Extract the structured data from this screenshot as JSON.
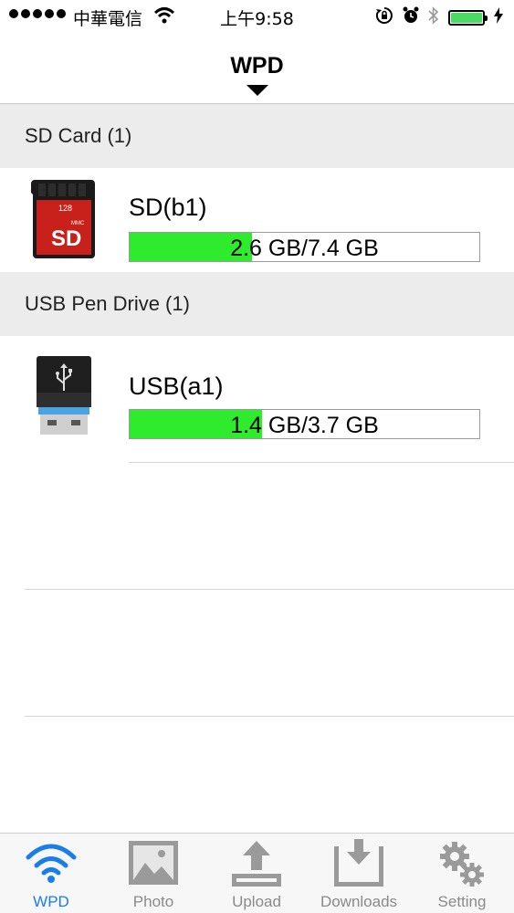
{
  "status_bar": {
    "carrier": "中華電信",
    "time": "上午9:58"
  },
  "nav": {
    "title": "WPD"
  },
  "sections": [
    {
      "header": "SD Card (1)",
      "device": {
        "name": "SD(b1)",
        "icon": "sd-card-icon",
        "icon_text_top": "128",
        "icon_text_brand": "MMC",
        "icon_text_main": "SD",
        "capacity_text": "2.6 GB/7.4 GB",
        "used_fraction": 0.351
      }
    },
    {
      "header": "USB Pen Drive (1)",
      "device": {
        "name": "USB(a1)",
        "icon": "usb-drive-icon",
        "capacity_text": "1.4 GB/3.7 GB",
        "used_fraction": 0.378
      }
    }
  ],
  "tabs": [
    {
      "label": "WPD",
      "icon": "wifi-icon",
      "active": true
    },
    {
      "label": "Photo",
      "icon": "photo-icon",
      "active": false
    },
    {
      "label": "Upload",
      "icon": "upload-icon",
      "active": false
    },
    {
      "label": "Downloads",
      "icon": "downloads-icon",
      "active": false
    },
    {
      "label": "Setting",
      "icon": "gear-icon",
      "active": false
    }
  ],
  "colors": {
    "accent": "#1a7ee8",
    "capacity_fill": "#2eeb2e",
    "battery": "#4cd964",
    "sd_card": "#c8211c"
  }
}
